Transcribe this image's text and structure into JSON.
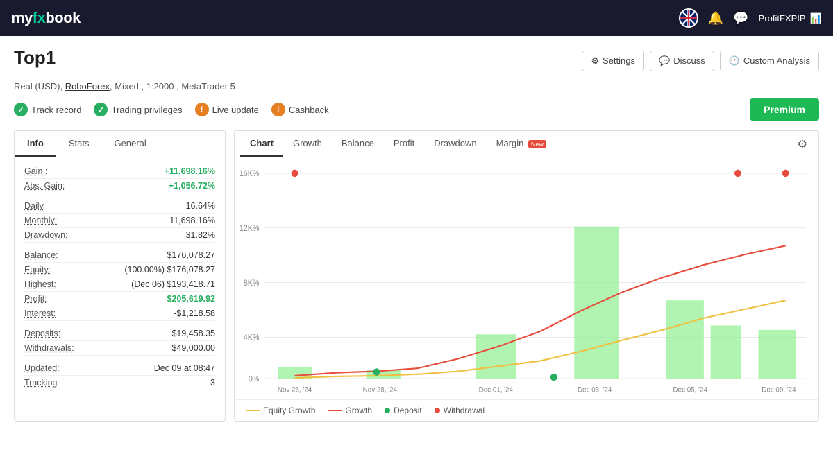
{
  "header": {
    "logo": "myfxbook",
    "logo_fx": "fx",
    "username": "ProfitFXPIP",
    "nav_icons": [
      "bell",
      "chat"
    ]
  },
  "page": {
    "title": "Top1",
    "account_info": "Real (USD), RoboForex, Mixed , 1:2000 , MetaTrader 5"
  },
  "top_actions": {
    "settings_label": "Settings",
    "discuss_label": "Discuss",
    "custom_analysis_label": "Custom Analysis"
  },
  "status_items": [
    {
      "label": "Track record",
      "type": "green"
    },
    {
      "label": "Trading privileges",
      "type": "green"
    },
    {
      "label": "Live update",
      "type": "orange"
    },
    {
      "label": "Cashback",
      "type": "orange"
    }
  ],
  "premium_label": "Premium",
  "left_panel": {
    "tabs": [
      "Info",
      "Stats",
      "General"
    ],
    "active_tab": "Info",
    "rows": [
      {
        "label": "Gain :",
        "value": "+11,698.16%",
        "color": "green"
      },
      {
        "label": "Abs. Gain:",
        "value": "+1,056.72%",
        "color": "green"
      },
      {
        "label": "Daily",
        "value": "16.64%",
        "color": "normal"
      },
      {
        "label": "Monthly:",
        "value": "11,698.16%",
        "color": "normal"
      },
      {
        "label": "Drawdown:",
        "value": "31.82%",
        "color": "normal"
      },
      {
        "label": "Balance:",
        "value": "$176,078.27",
        "color": "normal"
      },
      {
        "label": "Equity:",
        "value": "(100.00%) $176,078.27",
        "color": "normal"
      },
      {
        "label": "Highest:",
        "value": "(Dec 06) $193,418.71",
        "color": "normal"
      },
      {
        "label": "Profit:",
        "value": "$205,619.92",
        "color": "green"
      },
      {
        "label": "Interest:",
        "value": "-$1,218.58",
        "color": "normal"
      },
      {
        "label": "Deposits:",
        "value": "$19,458.35",
        "color": "normal"
      },
      {
        "label": "Withdrawals:",
        "value": "$49,000.00",
        "color": "normal"
      },
      {
        "label": "Updated:",
        "value": "Dec 09 at 08:47",
        "color": "normal"
      },
      {
        "label": "Tracking",
        "value": "3",
        "color": "normal"
      }
    ]
  },
  "right_panel": {
    "tabs": [
      "Chart",
      "Growth",
      "Balance",
      "Profit",
      "Drawdown",
      "Margin"
    ],
    "active_tab": "Chart",
    "margin_badge": "New",
    "legend": [
      {
        "type": "line-yellow",
        "label": "Equity Growth"
      },
      {
        "type": "line-red",
        "label": "Growth"
      },
      {
        "type": "dot-green",
        "label": "Deposit"
      },
      {
        "type": "dot-red",
        "label": "Withdrawal"
      }
    ],
    "x_labels": [
      "Nov 26, '24",
      "Nov 28, '24",
      "Dec 01, '24",
      "Dec 03, '24",
      "Dec 05, '24",
      "Dec 09, '24"
    ],
    "y_labels": [
      "0%",
      "4K%",
      "8K%",
      "12K%",
      "16K%"
    ]
  }
}
